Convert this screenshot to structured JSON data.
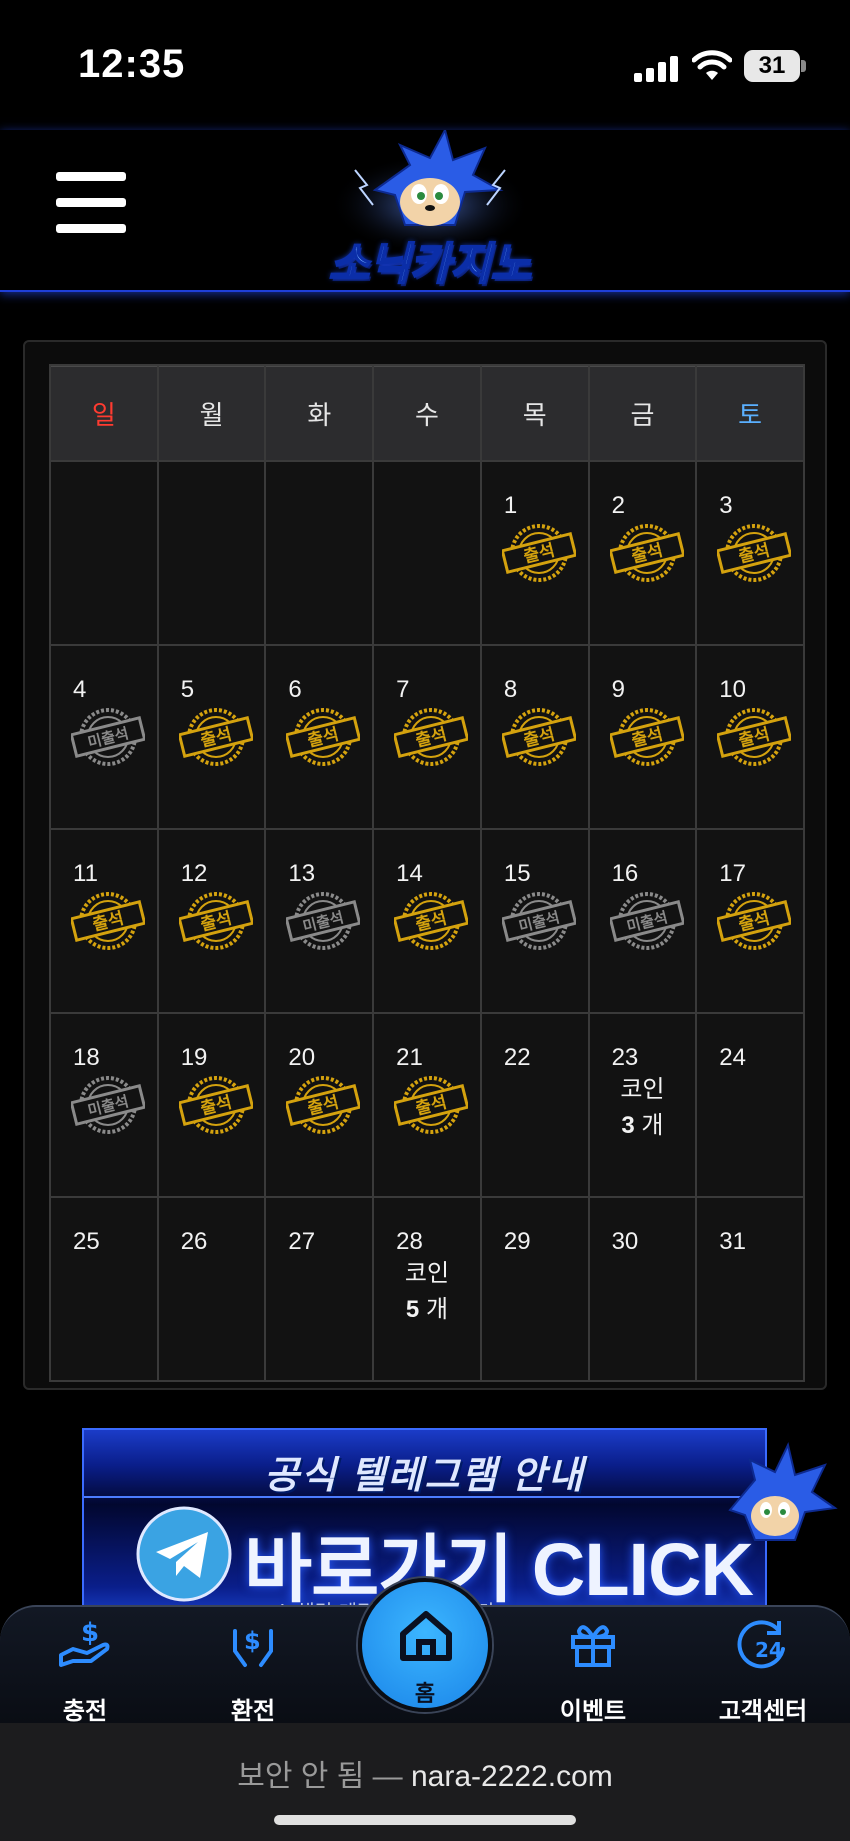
{
  "status_bar": {
    "time": "12:35",
    "battery": "31"
  },
  "header": {
    "logo_text": "소닉카지노"
  },
  "calendar": {
    "weekdays": [
      {
        "label": "일",
        "type": "sun"
      },
      {
        "label": "월",
        "type": ""
      },
      {
        "label": "화",
        "type": ""
      },
      {
        "label": "수",
        "type": ""
      },
      {
        "label": "목",
        "type": ""
      },
      {
        "label": "금",
        "type": ""
      },
      {
        "label": "토",
        "type": "sat"
      }
    ],
    "stamp_labels": {
      "attended": "출석",
      "absent": "미출석"
    },
    "colors": {
      "attended": "#d4a20e",
      "absent": "#8a8a8a"
    },
    "days": [
      {
        "date": ""
      },
      {
        "date": ""
      },
      {
        "date": ""
      },
      {
        "date": ""
      },
      {
        "date": "1",
        "status": "attended"
      },
      {
        "date": "2",
        "status": "attended"
      },
      {
        "date": "3",
        "status": "attended"
      },
      {
        "date": "4",
        "status": "absent"
      },
      {
        "date": "5",
        "status": "attended"
      },
      {
        "date": "6",
        "status": "attended"
      },
      {
        "date": "7",
        "status": "attended"
      },
      {
        "date": "8",
        "status": "attended"
      },
      {
        "date": "9",
        "status": "attended"
      },
      {
        "date": "10",
        "status": "attended"
      },
      {
        "date": "11",
        "status": "attended"
      },
      {
        "date": "12",
        "status": "attended"
      },
      {
        "date": "13",
        "status": "absent"
      },
      {
        "date": "14",
        "status": "attended"
      },
      {
        "date": "15",
        "status": "absent"
      },
      {
        "date": "16",
        "status": "absent"
      },
      {
        "date": "17",
        "status": "attended"
      },
      {
        "date": "18",
        "status": "absent"
      },
      {
        "date": "19",
        "status": "attended"
      },
      {
        "date": "20",
        "status": "attended"
      },
      {
        "date": "21",
        "status": "attended"
      },
      {
        "date": "22"
      },
      {
        "date": "23",
        "reward_label": "코인",
        "reward_count": "3",
        "reward_unit": "개"
      },
      {
        "date": "24"
      },
      {
        "date": "25"
      },
      {
        "date": "26"
      },
      {
        "date": "27"
      },
      {
        "date": "28",
        "reward_label": "코인",
        "reward_count": "5",
        "reward_unit": "개"
      },
      {
        "date": "29"
      },
      {
        "date": "30"
      },
      {
        "date": "31"
      }
    ]
  },
  "banner": {
    "title": "공식 텔레그램 안내",
    "cta": "바로가기 CLICK",
    "note": "※ 해당 계정 ... 사칭입니다"
  },
  "bottom_nav": {
    "items": [
      {
        "label": "충전",
        "icon": "charge-icon"
      },
      {
        "label": "환전",
        "icon": "exchange-icon"
      },
      {
        "label": "이벤트",
        "icon": "gift-icon"
      },
      {
        "label": "고객센터",
        "icon": "support-24-icon"
      }
    ],
    "home_label": "홈"
  },
  "browser": {
    "insecure_label": "보안 안 됨 —",
    "url": "nara-2222.com"
  }
}
